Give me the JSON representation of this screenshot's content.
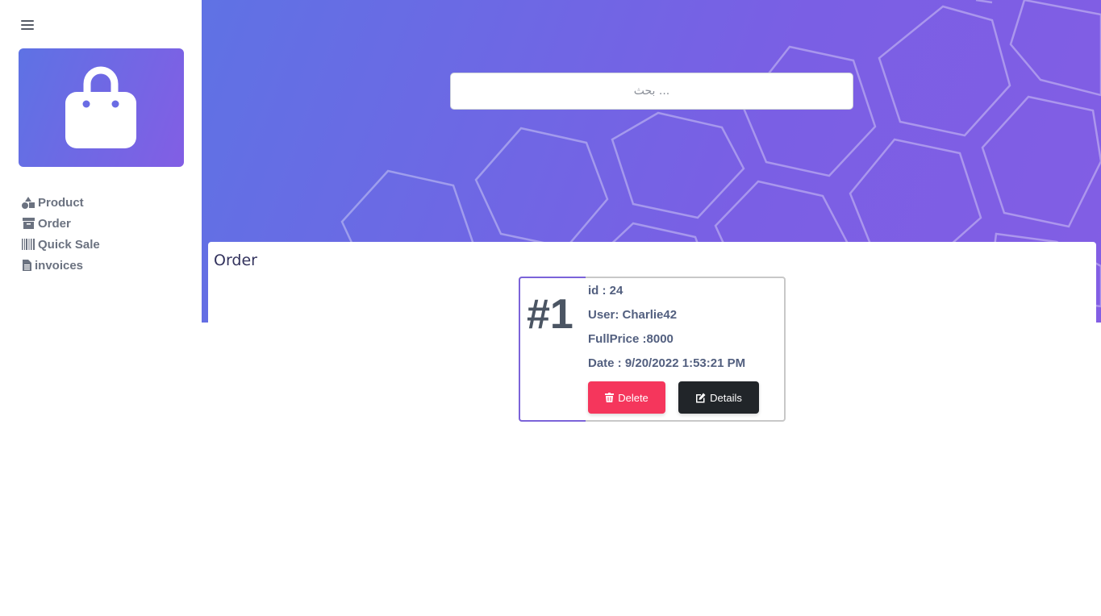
{
  "sidebar": {
    "menu_icon": "hamburger-icon",
    "logo_icon": "shopping-bag-icon",
    "items": [
      {
        "label": "Product",
        "icon": "shapes-icon"
      },
      {
        "label": "Order",
        "icon": "archive-box-icon"
      },
      {
        "label": "Quick Sale",
        "icon": "barcode-icon"
      },
      {
        "label": "invoices",
        "icon": "file-document-icon"
      }
    ]
  },
  "header": {
    "search_placeholder": "بحث ..."
  },
  "content": {
    "title": "Order",
    "order": {
      "number": "#1",
      "id": "id : 24",
      "user": "User: Charlie42",
      "full_price": "FullPrice :8000",
      "date": "Date : 9/20/2022 1:53:21 PM",
      "delete_label": "Delete",
      "details_label": "Details"
    }
  },
  "colors": {
    "brand_gradient_start": "#5e72e4",
    "brand_gradient_end": "#825ee4",
    "delete": "#f5365c",
    "details": "#212529"
  }
}
